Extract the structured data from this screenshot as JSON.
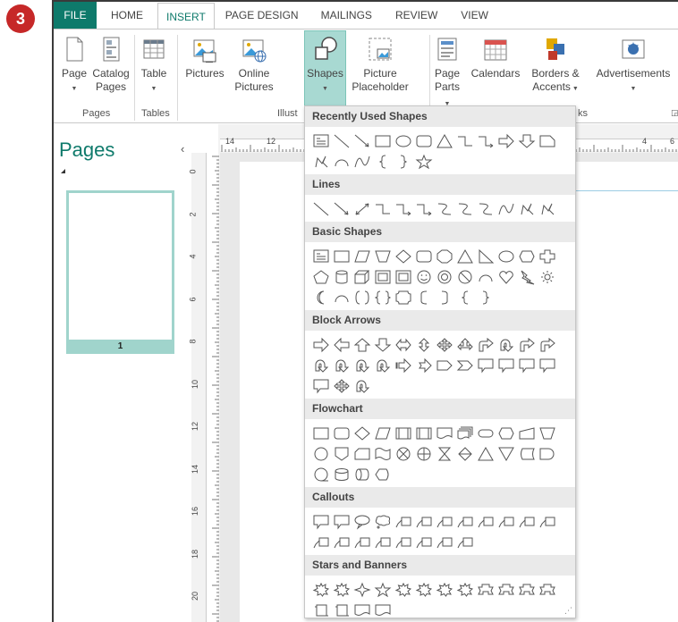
{
  "badge": "3",
  "tabs": [
    "FILE",
    "HOME",
    "INSERT",
    "PAGE DESIGN",
    "MAILINGS",
    "REVIEW",
    "VIEW"
  ],
  "ribbon": {
    "page": "Page",
    "catalog1": "Catalog",
    "catalog2": "Pages",
    "table": "Table",
    "pictures": "Pictures",
    "online1": "Online",
    "online2": "Pictures",
    "shapes": "Shapes",
    "placeholder1": "Picture",
    "placeholder2": "Placeholder",
    "parts1": "Page",
    "parts2": "Parts",
    "calendars": "Calendars",
    "borders1": "Borders &",
    "borders2": "Accents",
    "ads": "Advertisements",
    "groups": {
      "pages": "Pages",
      "tables": "Tables",
      "illus": "Illust",
      "blocks": "ks"
    }
  },
  "pane": {
    "title": "Pages",
    "close": "‹",
    "thumb_num": "1"
  },
  "rulers": {
    "h": [
      "14",
      "12",
      "4",
      "6"
    ],
    "v": [
      "0",
      "2",
      "4",
      "6",
      "8",
      "10",
      "12",
      "14",
      "16",
      "18",
      "20"
    ]
  },
  "gallery": {
    "sections": [
      {
        "title": "Recently Used Shapes",
        "rows": [
          [
            "textbox",
            "line",
            "arrow-line",
            "rect",
            "oval",
            "rounded-rect",
            "triangle",
            "elbow",
            "elbow-arrow",
            "right-arrow",
            "down-arrow",
            "snip"
          ],
          [
            "squiggle",
            "arc",
            "curve",
            "left-brace",
            "right-brace",
            "star"
          ]
        ]
      },
      {
        "title": "Lines",
        "rows": [
          [
            "line",
            "arrow-line",
            "double-arrow-line",
            "elbow",
            "elbow-arrow",
            "elbow-double",
            "curve-s",
            "curve-arrow",
            "curve-double",
            "curve",
            "freeform",
            "squiggle"
          ]
        ]
      },
      {
        "title": "Basic Shapes",
        "rows": [
          [
            "textbox",
            "rect",
            "parallelogram",
            "trapezoid",
            "diamond",
            "rounded-rect",
            "octagon",
            "triangle",
            "right-triangle",
            "oval",
            "hexagon",
            "cross"
          ],
          [
            "pentagon",
            "can",
            "cube",
            "frame",
            "bevel",
            "smiley",
            "donut",
            "no-symbol",
            "arc",
            "heart",
            "lightning",
            "sun"
          ],
          [
            "moon",
            "arc",
            "brackets",
            "double-brace",
            "plaque",
            "left-bracket",
            "right-bracket",
            "left-brace",
            "right-brace"
          ]
        ]
      },
      {
        "title": "Block Arrows",
        "rows": [
          [
            "right-arrow",
            "left-arrow",
            "up-arrow",
            "down-arrow",
            "left-right-arrow",
            "up-down-arrow",
            "quad-arrow",
            "left-right-up-arrow",
            "bent-arrow",
            "u-turn-arrow",
            "left-up-arrow",
            "bent-up-arrow"
          ],
          [
            "curved-right",
            "curved-left",
            "curved-up",
            "curved-down",
            "striped-right",
            "notched-right",
            "pentagon-arrow",
            "chevron",
            "right-callout",
            "down-callout",
            "left-callout",
            "up-callout"
          ],
          [
            "left-right-callout",
            "quad-callout",
            "circular-arrow"
          ]
        ]
      },
      {
        "title": "Flowchart",
        "rows": [
          [
            "fc-process",
            "fc-alt-process",
            "fc-decision",
            "fc-data",
            "fc-predefined",
            "fc-internal",
            "fc-document",
            "fc-multidoc",
            "fc-terminator",
            "fc-preparation",
            "fc-manual-input",
            "fc-manual-op"
          ],
          [
            "fc-connector",
            "fc-offpage",
            "fc-card",
            "fc-tape",
            "fc-summing",
            "fc-or",
            "fc-collate",
            "fc-sort",
            "fc-extract",
            "fc-merge",
            "fc-stored",
            "fc-delay"
          ],
          [
            "fc-seq-access",
            "fc-magnetic",
            "fc-direct",
            "fc-display"
          ]
        ]
      },
      {
        "title": "Callouts",
        "rows": [
          [
            "rect-callout",
            "rounded-callout",
            "oval-callout",
            "cloud-callout",
            "line-callout1",
            "line-callout2",
            "line-callout3",
            "line-callout4",
            "line-callout1b",
            "line-callout2b",
            "line-callout3b",
            "line-callout4b"
          ],
          [
            "line-callout1c",
            "line-callout2c",
            "line-callout3c",
            "line-callout4c",
            "line-callout1d",
            "line-callout2d",
            "line-callout3d",
            "line-callout4d"
          ]
        ]
      },
      {
        "title": "Stars and Banners",
        "rows": [
          [
            "explosion1",
            "explosion2",
            "star4",
            "star5",
            "star6",
            "star7",
            "star8",
            "star10",
            "ribbon-up",
            "ribbon-down",
            "curved-ribbon-up",
            "curved-ribbon-down"
          ],
          [
            "vertical-scroll",
            "horizontal-scroll",
            "wave",
            "double-wave"
          ]
        ]
      }
    ]
  },
  "colors": {
    "accent": "#0e7a6b",
    "highlight": "#a8d9d2",
    "badge": "#c62828"
  }
}
